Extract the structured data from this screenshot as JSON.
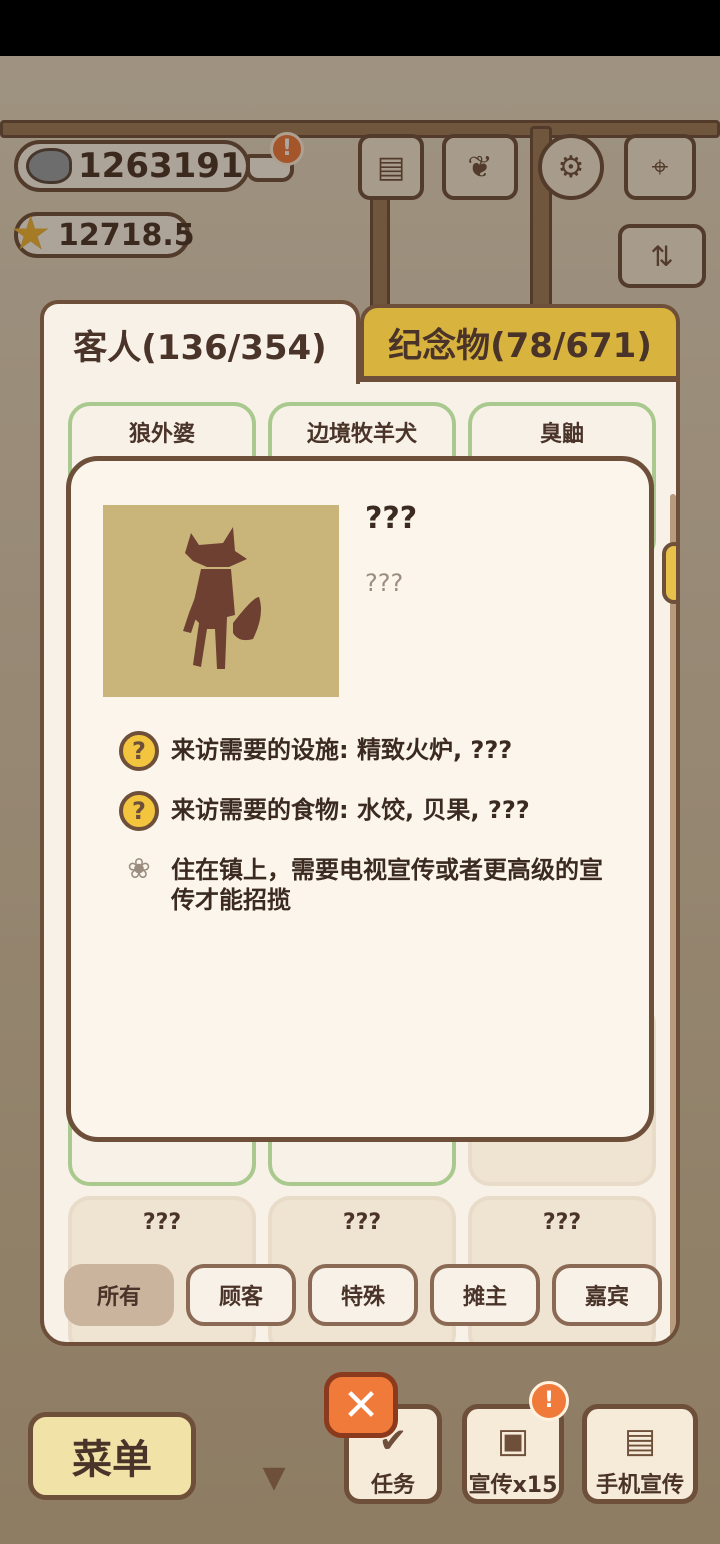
{
  "currency": {
    "fish": "1263191",
    "stars": "12718.5"
  },
  "icons": {
    "alert": "!",
    "close": "✕"
  },
  "tabs": [
    {
      "label": "客人(136/354)",
      "active": true
    },
    {
      "label": "纪念物(78/671)",
      "active": false
    }
  ],
  "cards": [
    {
      "label": "狼外婆"
    },
    {
      "label": "边境牧羊犬"
    },
    {
      "label": "臭鼬"
    },
    {
      "label": "???"
    },
    {
      "label": "???"
    },
    {
      "label": "???"
    }
  ],
  "filters": [
    {
      "label": "所有",
      "active": true
    },
    {
      "label": "顾客",
      "active": false
    },
    {
      "label": "特殊",
      "active": false
    },
    {
      "label": "摊主",
      "active": false
    },
    {
      "label": "嘉宾",
      "active": false
    }
  ],
  "modal": {
    "name": "???",
    "subtitle": "???",
    "requirements": [
      {
        "icon": "question-icon",
        "text": "来访需要的设施: 精致火炉, ???"
      },
      {
        "icon": "question-icon",
        "text": "来访需要的食物: 水饺, 贝果, ???"
      },
      {
        "icon": "paw-icon",
        "text": "住在镇上，需要电视宣传或者更高级的宣传才能招揽"
      }
    ]
  },
  "bottom": {
    "menu": "菜单",
    "tasks": "任务",
    "promo": "宣传x15",
    "phone_promo": "手机宣传"
  },
  "colors": {
    "outline": "#6d4f3a",
    "panel": "#f7f1e7",
    "tab_inactive": "#d8b33e",
    "card_border": "#a9c98e",
    "accent_orange": "#f07a3a",
    "portrait_bg": "#c9b57a"
  }
}
